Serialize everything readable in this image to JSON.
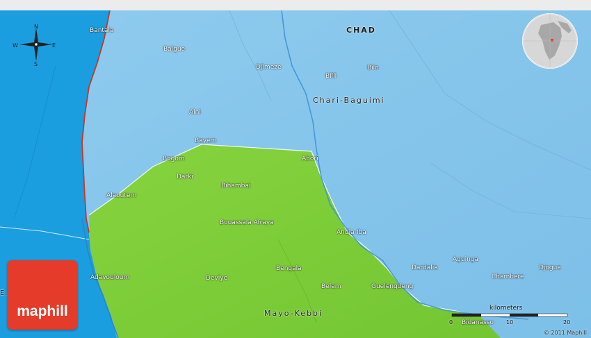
{
  "map": {
    "country_label": "CHAD",
    "regions": {
      "north": "Chari-Baguimi",
      "south": "Mayo-Kebbi"
    },
    "edge_label": "E...",
    "places": [
      {
        "id": "bantala",
        "name": "Bantala"
      },
      {
        "id": "balgue",
        "name": "Balgue"
      },
      {
        "id": "djimeze",
        "name": "Djimeze"
      },
      {
        "id": "billi",
        "name": "Billi"
      },
      {
        "id": "bilo",
        "name": "Bilo"
      },
      {
        "id": "aini",
        "name": "Aini"
      },
      {
        "id": "bayem",
        "name": "Bayem"
      },
      {
        "id": "bogom",
        "name": "Bogom"
      },
      {
        "id": "abori",
        "name": "Abori"
      },
      {
        "id": "darki",
        "name": "Darki"
      },
      {
        "id": "bihambai",
        "name": "Bihambai"
      },
      {
        "id": "alaoutem",
        "name": "Alaoutem"
      },
      {
        "id": "bouassala-afraya",
        "name": "Bouassala Afraya"
      },
      {
        "id": "andja-iba",
        "name": "Andja-Iba"
      },
      {
        "id": "dardalia",
        "name": "Dardalia"
      },
      {
        "id": "aguinga",
        "name": "Aguinga"
      },
      {
        "id": "chambere",
        "name": "Chambere"
      },
      {
        "id": "djogue",
        "name": "Djogue"
      },
      {
        "id": "bengala",
        "name": "Bengala"
      },
      {
        "id": "adavouloum",
        "name": "Adavouloum"
      },
      {
        "id": "deviye",
        "name": "Deviye"
      },
      {
        "id": "belem",
        "name": "Belem"
      },
      {
        "id": "guelengdeng",
        "name": "Guelengdeng"
      },
      {
        "id": "bidanasso",
        "name": "Bidanasso"
      }
    ],
    "compass": {
      "n": "N",
      "s": "S",
      "e": "E",
      "w": "W"
    },
    "scale": {
      "title": "kilometers",
      "ticks": [
        "0",
        "10",
        "20"
      ]
    },
    "logo_text": "maphill",
    "credit": "© 2011 Maphill",
    "colors": {
      "chad_fill": "#84c4ec",
      "cameroon_fill": "#1a9ee0",
      "mayo_kebbi_fill": "#7fce3a",
      "border_line": "#c0392b",
      "logo_bg": "#e53b2a"
    }
  }
}
